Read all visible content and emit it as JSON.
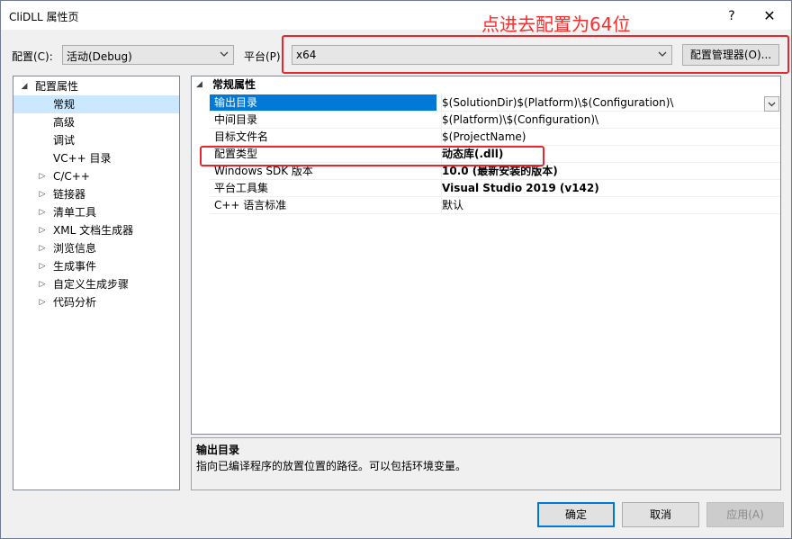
{
  "window": {
    "title": "CliDLL 属性页",
    "help_glyph": "?",
    "close_glyph": "✕"
  },
  "annotation": {
    "text": "点进去配置为64位",
    "color": "#ff2a2a"
  },
  "toolbar": {
    "config_label": "配置(C):",
    "config_value": "活动(Debug)",
    "platform_label": "平台(P):",
    "platform_value": "x64",
    "config_manager_label": "配置管理器(O)..."
  },
  "tree": {
    "root": {
      "label": "配置属性",
      "expander": "◢"
    },
    "items": [
      {
        "label": "常规",
        "selected": true,
        "expandable": false
      },
      {
        "label": "高级",
        "expandable": false
      },
      {
        "label": "调试",
        "expandable": false
      },
      {
        "label": "VC++ 目录",
        "expandable": false
      },
      {
        "label": "C/C++",
        "expandable": true
      },
      {
        "label": "链接器",
        "expandable": true
      },
      {
        "label": "清单工具",
        "expandable": true
      },
      {
        "label": "XML 文档生成器",
        "expandable": true
      },
      {
        "label": "浏览信息",
        "expandable": true
      },
      {
        "label": "生成事件",
        "expandable": true
      },
      {
        "label": "自定义生成步骤",
        "expandable": true
      },
      {
        "label": "代码分析",
        "expandable": true
      }
    ],
    "collapsed_glyph": "▷"
  },
  "grid": {
    "category": "常规属性",
    "category_glyph": "◢",
    "rows": [
      {
        "name": "输出目录",
        "value": "$(SolutionDir)$(Platform)\\$(Configuration)\\",
        "bold": false,
        "selected": true
      },
      {
        "name": "中间目录",
        "value": "$(Platform)\\$(Configuration)\\",
        "bold": false
      },
      {
        "name": "目标文件名",
        "value": "$(ProjectName)",
        "bold": false
      },
      {
        "name": "配置类型",
        "value": "动态库(.dll)",
        "bold": true
      },
      {
        "name": "Windows SDK 版本",
        "value": "10.0 (最新安装的版本)",
        "bold": true
      },
      {
        "name": "平台工具集",
        "value": "Visual Studio 2019 (v142)",
        "bold": true
      },
      {
        "name": "C++ 语言标准",
        "value": "默认",
        "bold": false
      }
    ]
  },
  "description": {
    "title": "输出目录",
    "text": "指向已编译程序的放置位置的路径。可以包括环境变量。"
  },
  "buttons": {
    "ok": "确定",
    "cancel": "取消",
    "apply": "应用(A)"
  },
  "colors": {
    "highlight_box": "#e8262e",
    "selection": "#0078d7",
    "tree_selection": "#cce8ff"
  },
  "icons": {
    "dropdown": "chevron-down-icon",
    "expander_open": "expanded-triangle-icon",
    "expander_closed": "collapsed-triangle-icon"
  }
}
